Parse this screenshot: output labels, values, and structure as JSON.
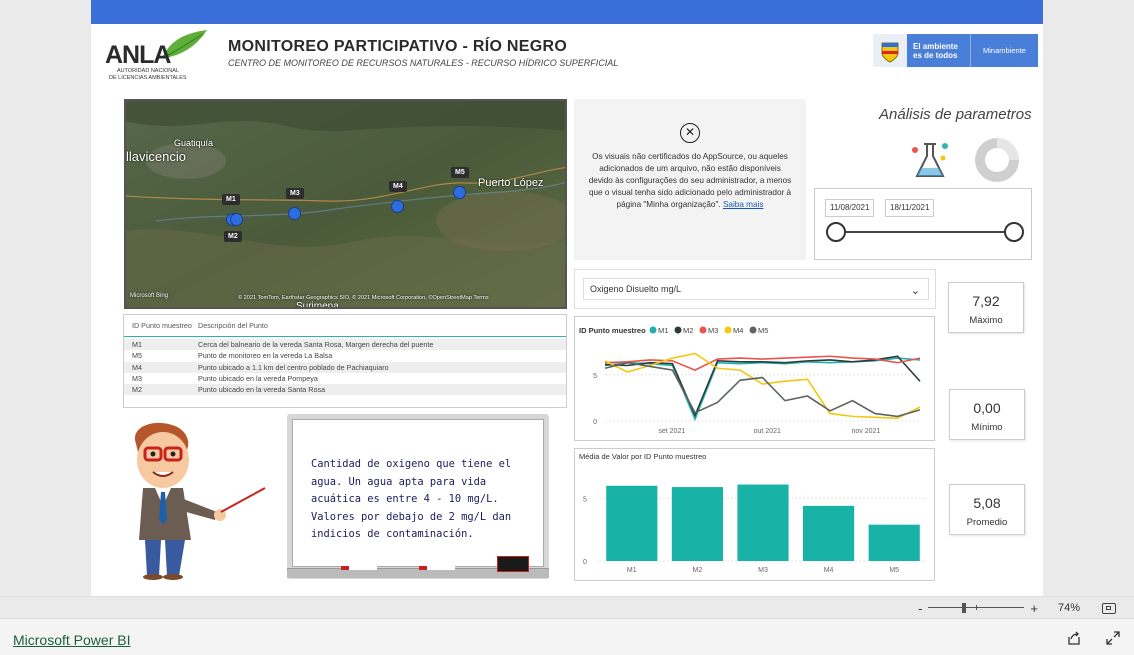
{
  "header": {
    "logo_text": "ANLA",
    "logo_sub1": "AUTORIDAD NACIONAL",
    "logo_sub2": "DE LICENCIAS AMBIENTALES",
    "title": "MONITOREO PARTICIPATIVO - RÍO NEGRO",
    "subtitle": "CENTRO DE MONITOREO DE RECURSOS NATURALES - RECURSO HÍDRICO SUPERFICIAL",
    "gov_line1": "El ambiente",
    "gov_line2": "es de todos",
    "gov_ministry": "Minambiente"
  },
  "map": {
    "place_1": "Guatiquía",
    "place_2": "llavicencio",
    "place_3": "Puerto López",
    "place_4": "Surimena",
    "markers": [
      "M1",
      "M2",
      "M3",
      "M4",
      "M5"
    ],
    "bing": "Microsoft Bing",
    "attribution": "© 2021 TomTom, Earthstar Geographics SIO, © 2021 Microsoft Corporation, ©OpenStreetMap Terms"
  },
  "appsource": {
    "message": "Os visuais não certificados do AppSource, ou aqueles adicionados de um arquivo, não estão disponíveis devido às configurações do seu administrador, a menos que o visual tenha sido adicionado pelo administrador à página \"Minha organização\".",
    "link": "Saiba mais"
  },
  "params": {
    "title": "Análisis de parametros",
    "date_start": "11/08/2021",
    "date_end": "18/11/2021",
    "dropdown_value": "Oxigeno Disuelto mg/L"
  },
  "kpis": {
    "max_value": "7,92",
    "max_label": "Máximo",
    "min_value": "0,00",
    "min_label": "Mínimo",
    "avg_value": "5,08",
    "avg_label": "Promedio"
  },
  "table": {
    "col1": "ID Punto muestreo",
    "col2": "Descripción del Punto",
    "rows": [
      {
        "id": "M1",
        "desc": "Cerca del balneario de la vereda Santa Rosa, Margen derecha del puente"
      },
      {
        "id": "M5",
        "desc": "Punto de monitoreo en la vereda La Balsa"
      },
      {
        "id": "M4",
        "desc": "Punto ubicado a 1.1 km del centro poblado de Pachiaquiaro"
      },
      {
        "id": "M3",
        "desc": "Punto ubicado en la vereda Pompeya"
      },
      {
        "id": "M2",
        "desc": "Punto ubicado en la vereda Santa Rosa"
      }
    ]
  },
  "board": {
    "text": "Cantidad de oxigeno que tiene el agua. Un agua apta para vida acuática es entre 4 - 10 mg/L. Valores por debajo de 2 mg/L dan indicios de contaminación."
  },
  "colors": {
    "M1": "#20b2aa",
    "M2": "#2e3b3b",
    "M3": "#e8544f",
    "M4": "#f2c80f",
    "M5": "#5e6560",
    "bar": "#18b2a6",
    "topbar": "#3a6fd8"
  },
  "chart_data": [
    {
      "type": "line",
      "title": "",
      "legend_title": "ID Punto muestreo",
      "legend_position": "top-left",
      "x_ticks": [
        "set 2021",
        "out 2021",
        "nov 2021"
      ],
      "y_ticks": [
        "0",
        "5"
      ],
      "ylim": [
        0,
        8
      ],
      "x": [
        "2021-08-11",
        "2021-08-18",
        "2021-08-25",
        "2021-09-01",
        "2021-09-08",
        "2021-09-15",
        "2021-09-22",
        "2021-09-29",
        "2021-10-06",
        "2021-10-13",
        "2021-10-20",
        "2021-10-27",
        "2021-11-03",
        "2021-11-10",
        "2021-11-18"
      ],
      "series": [
        {
          "name": "M1",
          "values": [
            6.0,
            6.3,
            6.2,
            6.0,
            0.2,
            6.3,
            6.2,
            6.3,
            6.2,
            6.4,
            6.3,
            6.4,
            6.5,
            6.8,
            6.6
          ]
        },
        {
          "name": "M2",
          "values": [
            6.1,
            6.0,
            6.3,
            6.2,
            0.6,
            6.5,
            6.4,
            6.4,
            6.3,
            6.5,
            6.6,
            6.4,
            6.6,
            7.0,
            4.3
          ]
        },
        {
          "name": "M3",
          "values": [
            6.3,
            6.4,
            6.6,
            6.5,
            5.5,
            6.7,
            6.8,
            6.7,
            6.8,
            6.9,
            7.0,
            6.8,
            6.7,
            6.3,
            6.8
          ]
        },
        {
          "name": "M4",
          "values": [
            6.5,
            5.3,
            6.0,
            6.8,
            7.3,
            5.7,
            5.5,
            4.0,
            4.3,
            4.5,
            0.8,
            0.5,
            0.4,
            0.3,
            1.5
          ]
        },
        {
          "name": "M5",
          "values": [
            5.7,
            6.3,
            5.9,
            5.5,
            0.9,
            2.0,
            4.4,
            4.7,
            2.2,
            2.7,
            1.1,
            2.2,
            0.8,
            0.5,
            1.2
          ]
        }
      ]
    },
    {
      "type": "bar",
      "title": "Média de Valor por ID Punto muestreo",
      "categories": [
        "M1",
        "M2",
        "M3",
        "M4",
        "M5"
      ],
      "values": [
        6.0,
        5.9,
        6.1,
        4.4,
        2.9
      ],
      "y_ticks": [
        "0",
        "5"
      ],
      "ylim": [
        0,
        7.5
      ]
    }
  ],
  "statusbar": {
    "zoom_minus": "-",
    "zoom_plus": "+",
    "zoom_level": "74%"
  },
  "footer": {
    "brand": "Microsoft Power BI"
  }
}
